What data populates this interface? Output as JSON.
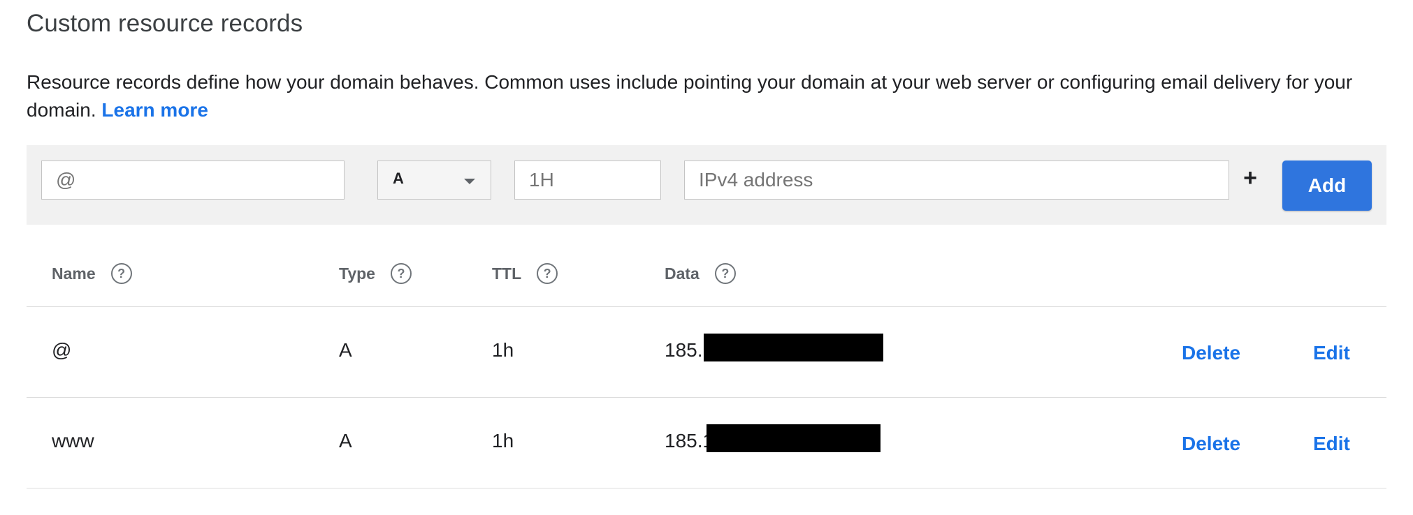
{
  "section": {
    "title": "Custom resource records",
    "description": "Resource records define how your domain behaves. Common uses include pointing your domain at your web server or configuring email delivery for your domain.",
    "learn_more": "Learn more"
  },
  "form": {
    "name_placeholder": "@",
    "type_selected": "A",
    "ttl_placeholder": "1H",
    "data_placeholder": "IPv4 address",
    "add_more_symbol": "+",
    "add_label": "Add"
  },
  "table": {
    "headers": {
      "name": "Name",
      "type": "Type",
      "ttl": "TTL",
      "data": "Data"
    },
    "help_symbol": "?",
    "rows": [
      {
        "name": "@",
        "type": "A",
        "ttl": "1h",
        "data": "185.",
        "delete": "Delete",
        "edit": "Edit"
      },
      {
        "name": "www",
        "type": "A",
        "ttl": "1h",
        "data": "185.1",
        "delete": "Delete",
        "edit": "Edit"
      }
    ]
  },
  "colors": {
    "accent": "#1a73e8",
    "button": "#2f75de",
    "toolbar_bg": "#f1f1f1"
  }
}
